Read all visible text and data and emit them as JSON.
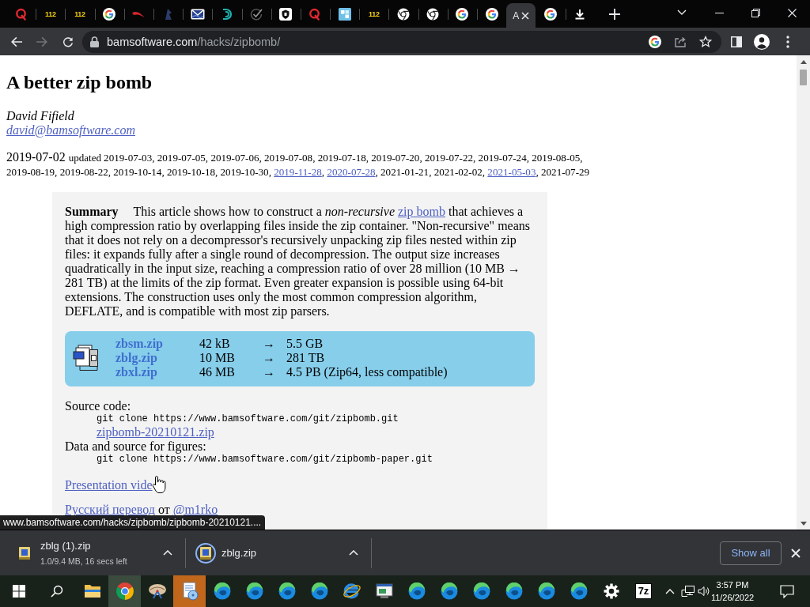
{
  "browser": {
    "tabs": [
      {
        "kind": "q-logo",
        "selected": false
      },
      {
        "kind": "digits",
        "label": "112",
        "selected": false
      },
      {
        "kind": "digits",
        "label": "112",
        "selected": false
      },
      {
        "kind": "g-logo",
        "selected": false
      },
      {
        "kind": "swoosh",
        "selected": false
      },
      {
        "kind": "small-logo",
        "selected": false
      },
      {
        "kind": "envelope",
        "selected": false
      },
      {
        "kind": "arc-logo",
        "selected": false
      },
      {
        "kind": "check",
        "selected": false
      },
      {
        "kind": "shield",
        "selected": false
      },
      {
        "kind": "q-logo",
        "selected": false
      },
      {
        "kind": "tile",
        "selected": false
      },
      {
        "kind": "digits",
        "label": "112",
        "selected": false
      },
      {
        "kind": "ring-logo",
        "selected": false
      },
      {
        "kind": "ring-logo",
        "selected": false
      },
      {
        "kind": "g-logo",
        "selected": false
      },
      {
        "kind": "g-logo",
        "selected": false
      },
      {
        "kind": "title",
        "title": "A",
        "selected": true
      },
      {
        "kind": "g-logo",
        "selected": false
      },
      {
        "kind": "download",
        "selected": false
      }
    ],
    "toolbar": {
      "back_disabled": false,
      "forward_disabled": true,
      "url_host": "bamsoftware.com",
      "url_path": "/hacks/zipbomb/"
    }
  },
  "page": {
    "title": "A better zip bomb",
    "author": "David Fifield",
    "email": "david@bamsoftware.com",
    "date": "2019-07-02",
    "updated_label": "updated",
    "updates": [
      {
        "kind": "text",
        "text": "2019-07-03, 2019-07-05, 2019-07-06, 2019-07-08, 2019-07-18, 2019-07-20, 2019-07-22, 2019-07-24, 2019-08-05, 2019-08-19, 2019-08-22, 2019-10-14, 2019-10-18, 2019-10-30, "
      },
      {
        "kind": "link",
        "text": "2019-11-28"
      },
      {
        "kind": "text",
        "text": ", "
      },
      {
        "kind": "link",
        "text": "2020-07-28"
      },
      {
        "kind": "text",
        "text": ", 2021-01-21, 2021-02-02, "
      },
      {
        "kind": "link",
        "text": "2021-05-03"
      },
      {
        "kind": "text",
        "text": ", 2021-07-29"
      }
    ],
    "summary": {
      "label": "Summary",
      "parts": [
        {
          "kind": "text",
          "text": "This article shows how to construct a *non-recursive* "
        },
        {
          "kind": "link",
          "text": "zip bomb"
        },
        {
          "kind": "text",
          "text": " that achieves a high compression ratio by overlapping files inside the zip container. \"Non-recursive\" means that it does not rely on a decompressor's recursively unpacking zip files nested within zip files: it expands fully after a single round of decompression. The output size increases quadratically in the input size, reaching a compression ratio of over 28 million (10 MB → 281 TB) at the limits of the zip format. Even greater expansion is possible using 64-bit extensions. The construction uses only the most common compression algorithm, DEFLATE, and is compatible with most zip parsers."
        }
      ]
    },
    "files": [
      {
        "file": "zbsm.zip",
        "size": "42 kB",
        "arrow": "→",
        "result": "5.5 GB"
      },
      {
        "file": "zblg.zip",
        "size": "10 MB",
        "arrow": "→",
        "result": "281 TB"
      },
      {
        "file": "zbxl.zip",
        "size": "46 MB",
        "arrow": "→",
        "result": "4.5 PB (Zip64, less compatible)"
      }
    ],
    "sections": [
      {
        "label": "Source code:",
        "lines": [
          {
            "kind": "code",
            "text": "git clone https://www.bamsoftware.com/git/zipbomb.git"
          },
          {
            "kind": "link",
            "text": "zipbomb-20210121.zip"
          }
        ]
      },
      {
        "label": "Data and source for figures:",
        "lines": [
          {
            "kind": "code",
            "text": "git clone https://www.bamsoftware.com/git/zipbomb-paper.git"
          }
        ]
      }
    ],
    "video_link": "Presentation vide",
    "translation": [
      {
        "kind": "link",
        "text": "Русский перевод"
      },
      {
        "kind": "text",
        "text": " от "
      },
      {
        "kind": "link",
        "text": "@m1rko"
      }
    ]
  },
  "status_bubble": "www.bamsoftware.com/hacks/zipbomb/zipbomb-20210121....",
  "download_shelf": {
    "items": [
      {
        "name": "zblg (1).zip",
        "status": "1.0/9.4 MB, 16 secs left",
        "ring": false
      },
      {
        "name": "zblg.zip",
        "ring": true
      }
    ],
    "show_all": "Show all"
  },
  "taskbar": {
    "apps": [
      {
        "kind": "folder",
        "active": false,
        "flashing": false
      },
      {
        "kind": "segmented-circle",
        "active": true,
        "flashing": false
      },
      {
        "kind": "shell",
        "active": false,
        "flashing": false
      },
      {
        "kind": "document",
        "active": false,
        "flashing": true
      },
      {
        "kind": "swirl",
        "active": false,
        "flashing": false
      },
      {
        "kind": "swirl",
        "active": false,
        "flashing": false
      },
      {
        "kind": "swirl",
        "active": false,
        "flashing": false
      },
      {
        "kind": "swirl",
        "active": false,
        "flashing": false
      },
      {
        "kind": "e-logo",
        "active": false,
        "flashing": false
      },
      {
        "kind": "window-app",
        "active": false,
        "flashing": false
      },
      {
        "kind": "swirl",
        "active": false,
        "flashing": false
      },
      {
        "kind": "swirl",
        "active": false,
        "flashing": false
      },
      {
        "kind": "swirl",
        "active": false,
        "flashing": false
      },
      {
        "kind": "swirl",
        "active": false,
        "flashing": false
      },
      {
        "kind": "swirl",
        "active": false,
        "flashing": false
      },
      {
        "kind": "swirl",
        "active": false,
        "flashing": false
      },
      {
        "kind": "gear",
        "active": false,
        "flashing": false
      },
      {
        "kind": "label",
        "label": "7z",
        "active": false,
        "flashing": false
      }
    ],
    "time": "3:57 PM",
    "date": "11/26/2022"
  }
}
